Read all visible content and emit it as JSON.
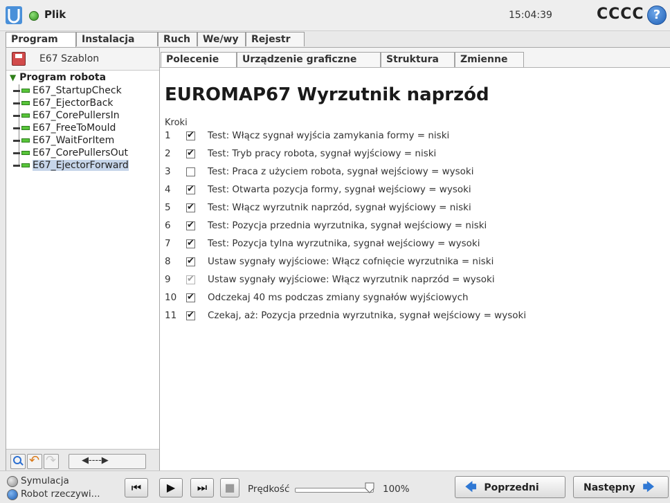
{
  "topbar": {
    "file_label": "Plik",
    "clock": "15:04:39",
    "robot_name": "CCCC",
    "help": "?"
  },
  "main_tabs": [
    "Program",
    "Instalacja",
    "Ruch",
    "We/wy",
    "Rejestr"
  ],
  "left": {
    "program_name": "E67 Szablon",
    "tree_root": "Program robota",
    "tree_items": [
      "E67_StartupCheck",
      "E67_EjectorBack",
      "E67_CorePullersIn",
      "E67_FreeToMould",
      "E67_WaitForItem",
      "E67_CorePullersOut",
      "E67_EjectorForward"
    ],
    "selected_index": 6
  },
  "sub_tabs": [
    "Polecenie",
    "Urządzenie graficzne",
    "Struktura",
    "Zmienne"
  ],
  "content": {
    "title": "EUROMAP67 Wyrzutnik naprzód",
    "steps_label": "Kroki",
    "steps": [
      {
        "num": "1",
        "state": "on",
        "text": "Test: Włącz sygnał wyjścia zamykania formy = niski"
      },
      {
        "num": "2",
        "state": "on",
        "text": "Test: Tryb pracy robota, sygnał wyjściowy = niski"
      },
      {
        "num": "3",
        "state": "off",
        "text": "Test: Praca z użyciem robota, sygnał wejściowy = wysoki"
      },
      {
        "num": "4",
        "state": "on",
        "text": "Test: Otwarta pozycja formy, sygnał wejściowy = wysoki"
      },
      {
        "num": "5",
        "state": "on",
        "text": "Test: Włącz wyrzutnik naprzód, sygnał wyjściowy = niski"
      },
      {
        "num": "6",
        "state": "on",
        "text": "Test: Pozycja przednia wyrzutnika, sygnał wejściowy = niski"
      },
      {
        "num": "7",
        "state": "on",
        "text": "Test: Pozycja tylna wyrzutnika, sygnał wejściowy = wysoki"
      },
      {
        "num": "8",
        "state": "on",
        "text": "Ustaw sygnały wyjściowe: Włącz cofnięcie wyrzutnika = niski"
      },
      {
        "num": "9",
        "state": "dim",
        "text": "Ustaw sygnały wyjściowe: Włącz wyrzutnik naprzód = wysoki"
      },
      {
        "num": "10",
        "state": "on",
        "text": "Odczekaj 40 ms podczas zmiany sygnałów wyjściowych"
      },
      {
        "num": "11",
        "state": "on",
        "text": "Czekaj, aż: Pozycja przednia wyrzutnika, sygnał wejściowy = wysoki"
      }
    ]
  },
  "bottom": {
    "sim_label": "Symulacja",
    "real_label": "Robot rzeczywi...",
    "speed_label": "Prędkość",
    "speed_value": "100%",
    "speed_fraction": 1.0,
    "prev_label": "Poprzedni",
    "next_label": "Następny"
  },
  "colors": {
    "accent_blue": "#2f78d4",
    "status_green": "#2f8f1d",
    "selection": "#c6d5ea"
  }
}
